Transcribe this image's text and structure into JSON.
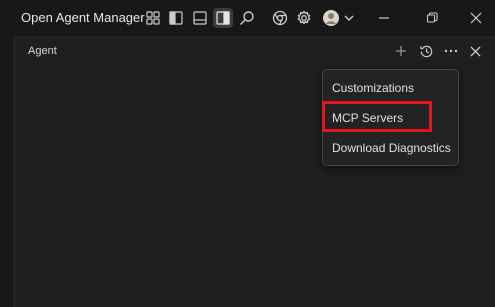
{
  "window": {
    "title": "Open Agent Manager"
  },
  "toolbar": {
    "icons": [
      "layout-icon",
      "toggle-primary-sidebar-icon",
      "toggle-panel-icon",
      "toggle-secondary-sidebar-icon",
      "search-icon",
      "browser-icon",
      "gear-icon",
      "account-avatar",
      "chevron-down-icon"
    ]
  },
  "panel": {
    "title": "Agent"
  },
  "menu": {
    "items": [
      {
        "label": "Customizations"
      },
      {
        "label": "MCP Servers"
      },
      {
        "label": "Download Diagnostics"
      }
    ]
  },
  "colors": {
    "highlight": "#e3161e",
    "background": "#1f1f1f"
  }
}
